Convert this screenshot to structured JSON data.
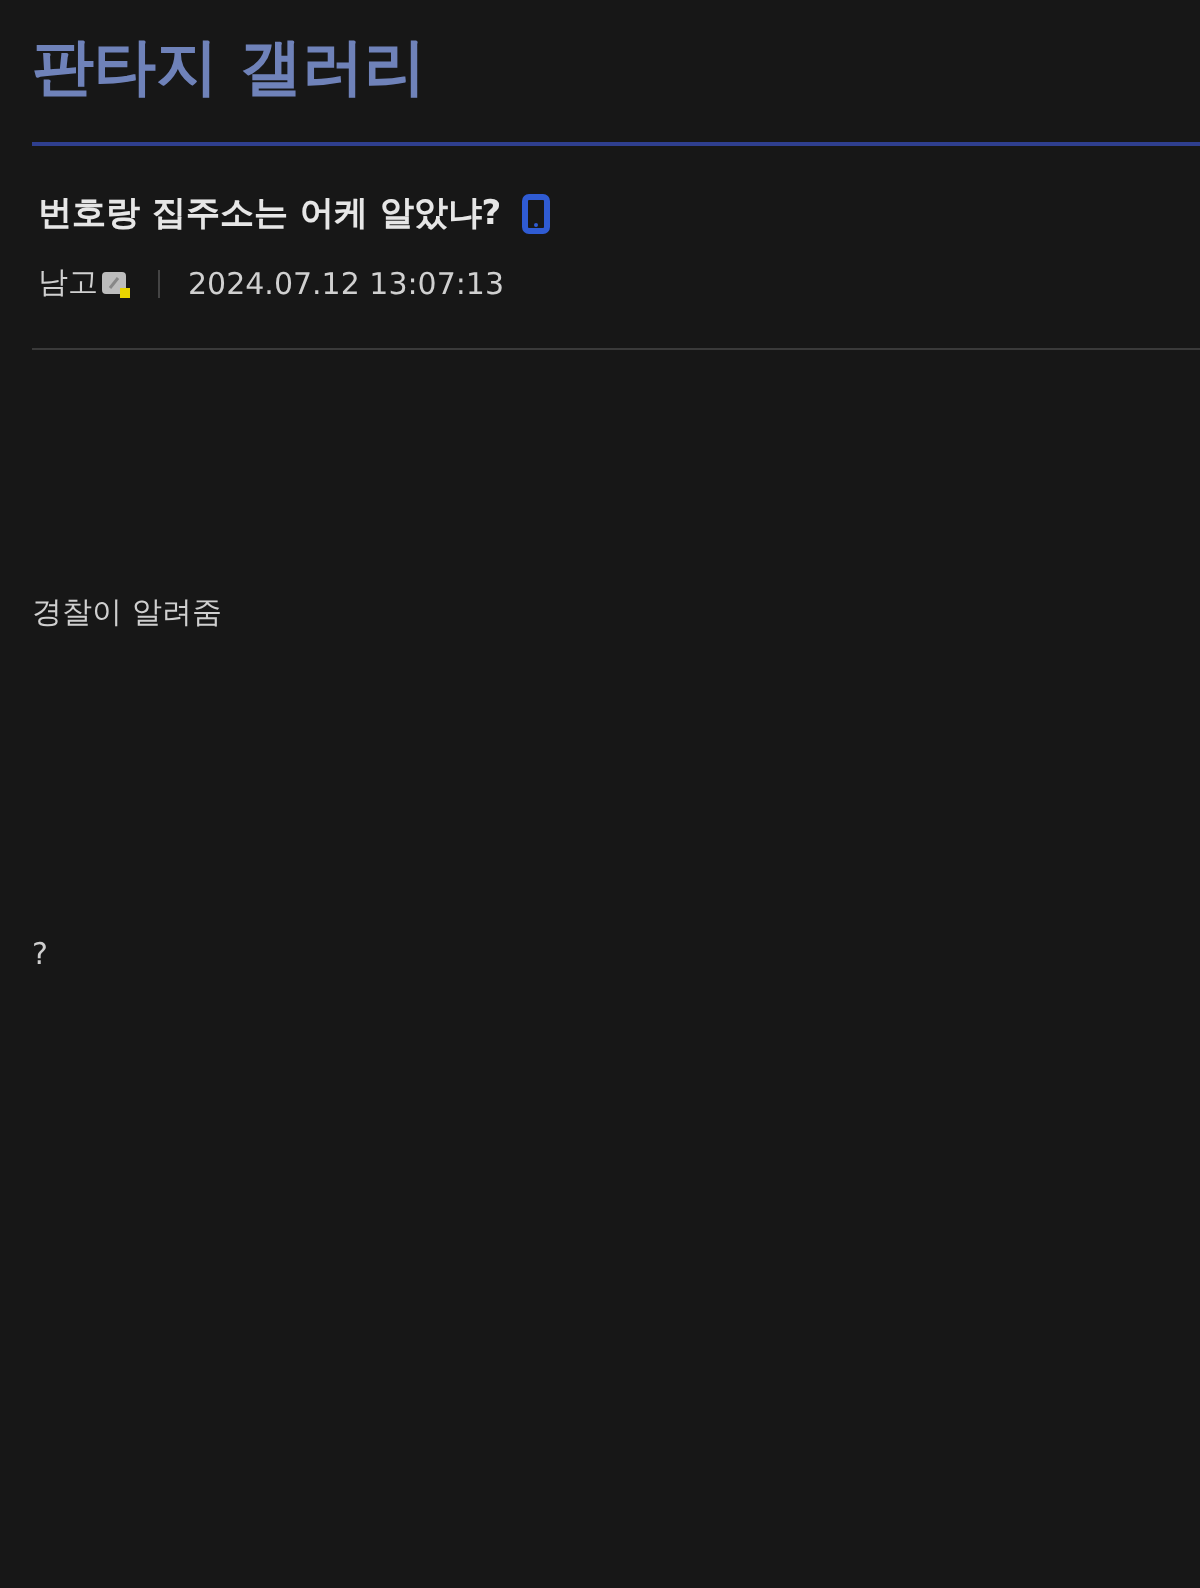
{
  "gallery": {
    "title": "판타지 갤러리"
  },
  "post": {
    "title": "번호랑 집주소는 어케 알았냐?",
    "mobile": true,
    "author": "남고",
    "author_badge": true,
    "date": "2024.07.12 13:07:13"
  },
  "body": [
    "경찰이 알려줌",
    "?"
  ]
}
